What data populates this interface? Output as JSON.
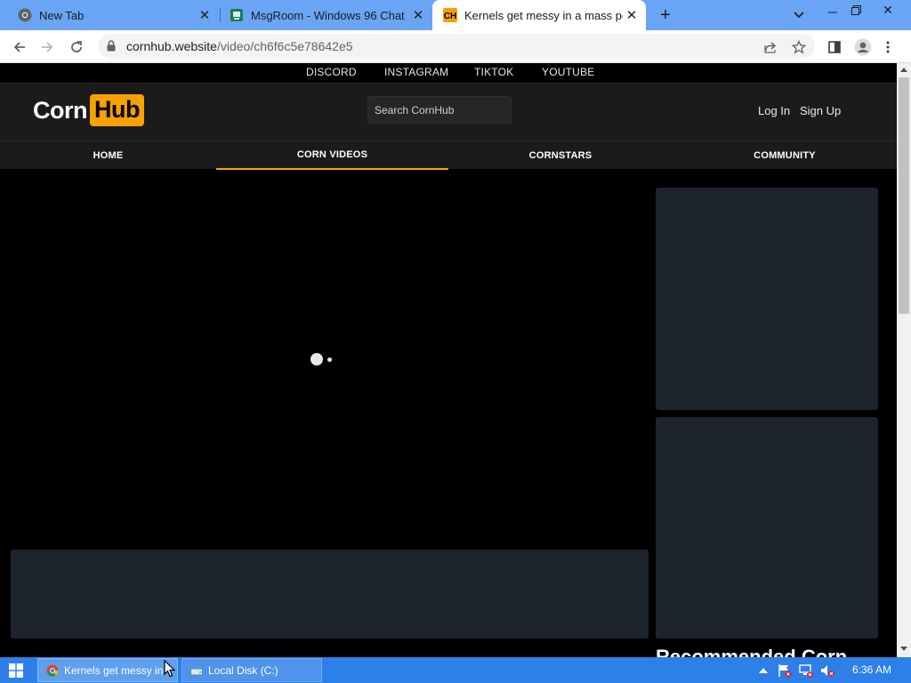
{
  "browser": {
    "tabs": [
      {
        "title": "New Tab",
        "icon": "chrome-icon",
        "active": false
      },
      {
        "title": "MsgRoom - Windows 96 Chat",
        "icon": "msgroom-icon",
        "active": false
      },
      {
        "title": "Kernels get messy in a mass pop",
        "icon": "cornhub-favicon",
        "favicon_text": "CH",
        "active": true
      }
    ],
    "url_host": "cornhub.website",
    "url_path": "/video/ch6f6c5e78642e5"
  },
  "site": {
    "social_links": [
      "DISCORD",
      "INSTAGRAM",
      "TIKTOK",
      "YOUTUBE"
    ],
    "logo": {
      "part1": "Corn",
      "part2": "Hub"
    },
    "search_placeholder": "Search CornHub",
    "auth": {
      "login": "Log In",
      "signup": "Sign Up"
    },
    "nav": [
      {
        "label": "HOME",
        "active": false
      },
      {
        "label": "CORN VIDEOS",
        "active": true
      },
      {
        "label": "CORNSTARS",
        "active": false
      },
      {
        "label": "COMMUNITY",
        "active": false
      }
    ],
    "video_title_partial": "",
    "recommended_heading_partial": "Recommended Corn"
  },
  "taskbar": {
    "tasks": [
      {
        "label": "Kernels get messy in",
        "icon": "chrome-icon",
        "active": true
      },
      {
        "label": "Local Disk (C:)",
        "icon": "drive-icon",
        "active": false
      }
    ],
    "clock": "6:36 AM"
  },
  "colors": {
    "accent": "#f7a100",
    "page_bg": "#000000",
    "header_bg": "#1b1b1b",
    "panel_bg": "#1d242d",
    "tab_strip": "#6aa5f5",
    "taskbar": "#2d80e8"
  }
}
